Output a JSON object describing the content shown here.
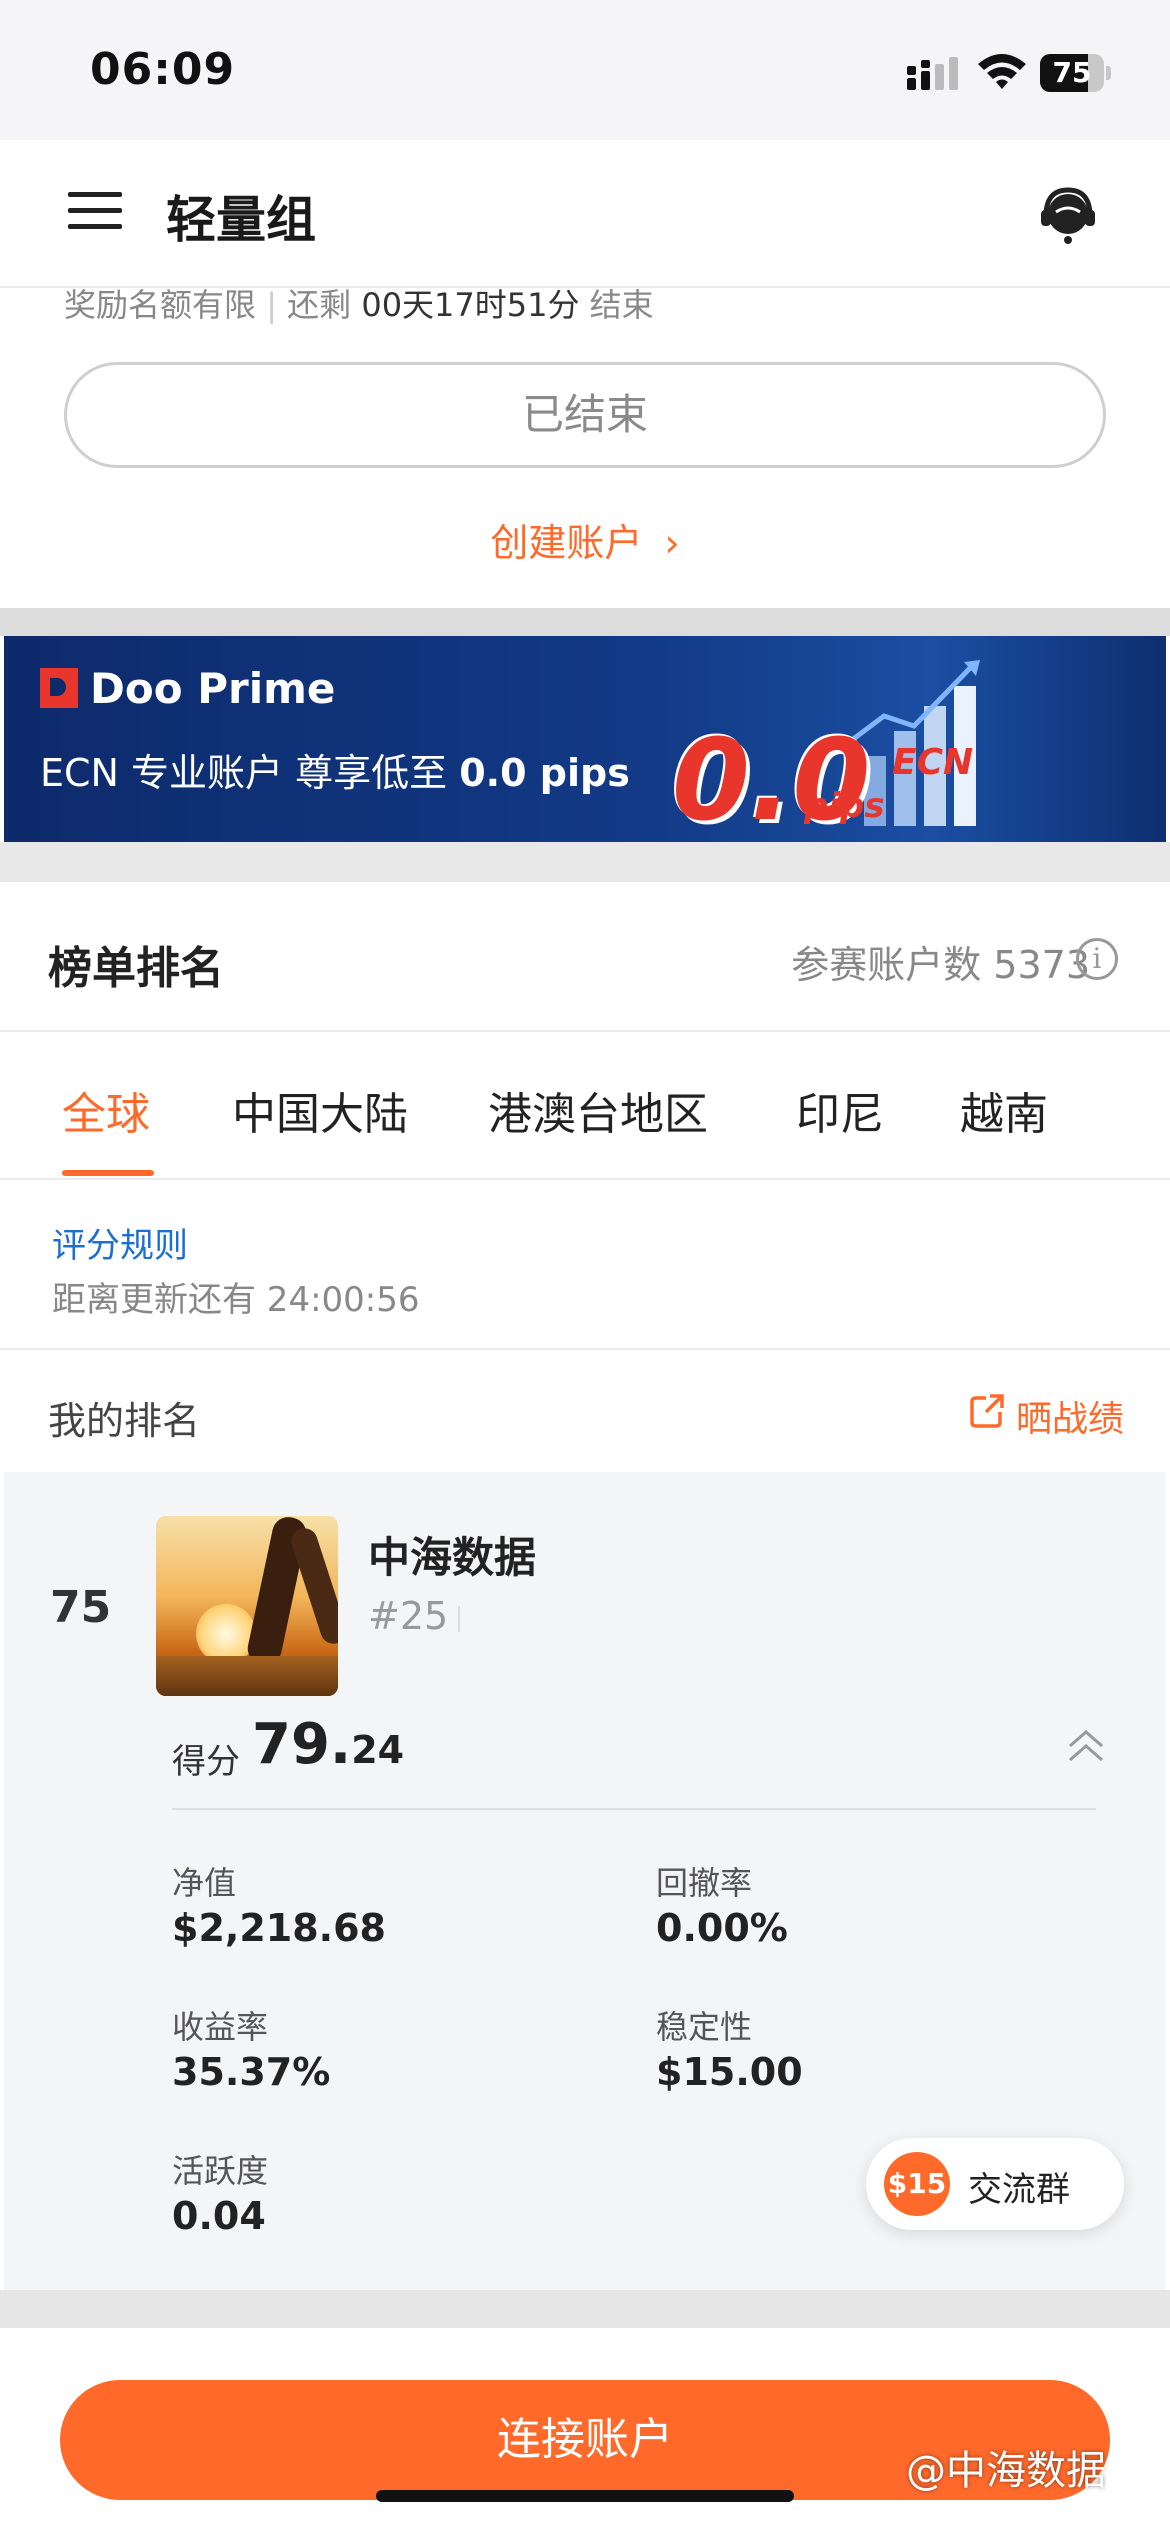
{
  "status_bar": {
    "time": "06:09",
    "battery": "75",
    "battery_level": 0.75
  },
  "header": {
    "title": "轻量组",
    "support_icon": "headset-icon",
    "menu_icon": "hamburger-icon"
  },
  "contest": {
    "partial_text_left": "奖励名额有限",
    "partial_text_remaining": "还剩",
    "partial_time": "00天17时51分",
    "partial_text_end": "结束",
    "ended_button": "已结束",
    "create_account": "创建账户"
  },
  "banner": {
    "brand": "Doo Prime",
    "text_prefix": "ECN 专业账户 尊享低至",
    "text_value": "0.0 pips",
    "big_number": "0.0",
    "pips": "pips",
    "ecn": "ECN"
  },
  "ranking": {
    "title": "榜单排名",
    "participants": "参赛账户数 5373",
    "tabs": [
      "全球",
      "中国大陆",
      "港澳台地区",
      "印尼",
      "越南"
    ],
    "active_tab": 0,
    "rules_link": "评分规则",
    "countdown": "距离更新还有 24:00:56"
  },
  "my_rank": {
    "label": "我的排名",
    "share": "晒战绩",
    "rank": "75",
    "username": "中海数据",
    "user_id": "#25",
    "score_label": "得分",
    "score_int": "79.",
    "score_dec": "24",
    "metrics": {
      "equity_label": "净值",
      "equity": "$2,218.68",
      "drawdown_label": "回撤率",
      "drawdown": "0.00%",
      "return_label": "收益率",
      "return": "35.37%",
      "stability_label": "稳定性",
      "stability": "$15.00",
      "activity_label": "活跃度",
      "activity": "0.04"
    }
  },
  "chat": {
    "badge": "$15",
    "label": "交流群"
  },
  "bottom": {
    "connect_button": "连接账户"
  },
  "watermark": "@中海数据",
  "colors": {
    "accent": "#ff6a2b",
    "link": "#1a6fd1",
    "banner_bg": "#123a86"
  }
}
